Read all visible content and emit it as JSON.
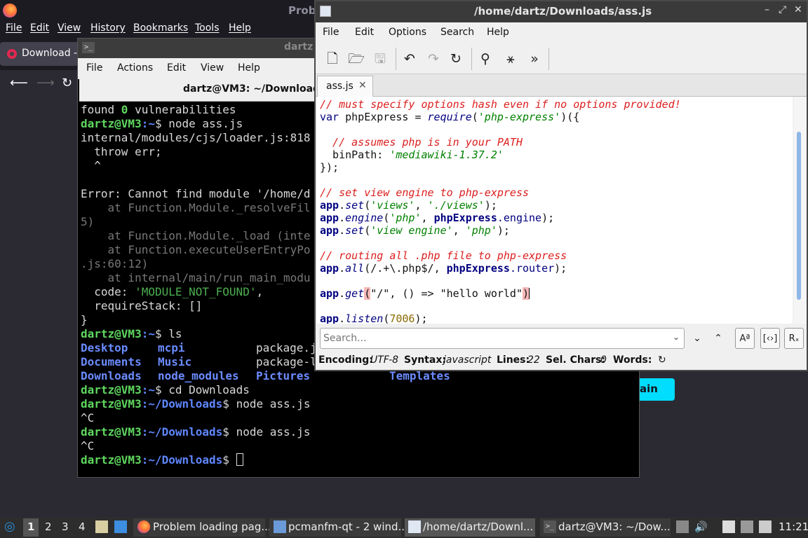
{
  "firefox": {
    "title": "Prob",
    "menu": [
      "File",
      "Edit",
      "View",
      "History",
      "Bookmarks",
      "Tools",
      "Help"
    ],
    "tab_label": "Download -",
    "partial_button": "ain"
  },
  "terminal": {
    "title_partial": "dartz",
    "menu": [
      "File",
      "Actions",
      "Edit",
      "View",
      "Help"
    ],
    "tab_title": "dartz@VM3: ~/Downloads",
    "lines": [
      "found 0 vulnerabilities",
      "dartz@VM3:~$ node ass.js",
      "internal/modules/cjs/loader.js:818",
      "  throw err;",
      "  ^",
      "",
      "Error: Cannot find module '/home/d",
      "    at Function.Module._resolveFil",
      "5)",
      "    at Function.Module._load (inte",
      "    at Function.executeUserEntryPo",
      ".js:60:12)",
      "    at internal/main/run_main_modu",
      "  code: 'MODULE_NOT_FOUND',",
      "  requireStack: []",
      "}",
      "dartz@VM3:~$ ls",
      "Desktop    mcpi           package.j",
      "Documents  Music          package-l",
      "Downloads  node_modules   Pictures         Templates",
      "dartz@VM3:~$ cd Downloads",
      "dartz@VM3:~/Downloads$ node ass.js",
      "^C",
      "dartz@VM3:~/Downloads$ node ass.js",
      "^C",
      "dartz@VM3:~/Downloads$ "
    ],
    "prompt_user": "dartz@VM3",
    "prompt_home": ":~",
    "prompt_dl": ":~/Downloads",
    "found": "found ",
    "zero": "0",
    "vuln": " vulnerabilities",
    "cmd_node": "$ node ass.js",
    "cmd_ls": "$ ls",
    "cmd_cd": "$ cd Downloads",
    "dollar": "$ ",
    "loader": "internal/modules/cjs/loader.js:818",
    "throw": "  throw err;",
    "caret": "  ^",
    "err": "Error: Cannot find module '/home/d",
    "at1": "    at Function.Module._resolveFil",
    "l5": "5)",
    "at2": "    at Function.Module._load (inte",
    "at3": "    at Function.executeUserEntryPo",
    "l60": ".js:60:12)",
    "at4": "    at internal/main/run_main_modu",
    "code_k": "  code: ",
    "code_v": "'MODULE_NOT_FOUND'",
    "code_c": ",",
    "req": "  requireStack: []",
    "brace": "}",
    "ls1a": "Desktop",
    "ls1b": "mcpi",
    "ls1c": "package.j",
    "ls2a": "Documents",
    "ls2b": "Music",
    "ls2c": "package-l",
    "ls3a": "Downloads",
    "ls3b": "node_modules",
    "ls3c": "Pictures",
    "ls3d": "Templates",
    "ctrlc": "^C"
  },
  "editor": {
    "title": "/home/dartz/Downloads/ass.js",
    "menu": [
      "File",
      "Edit",
      "Options",
      "Search",
      "Help"
    ],
    "tab": "ass.js",
    "search_placeholder": "Search...",
    "status": {
      "enc_k": "Encoding:",
      "enc_v": "UTF-8",
      "syn_k": "Syntax:",
      "syn_v": "javascript",
      "lines_k": "Lines:",
      "lines_v": "22",
      "sel_k": "Sel. Chars:",
      "sel_v": "0",
      "words_k": "Words:"
    },
    "code": {
      "c1": "// must specify options hash even if no options provided!",
      "var": "var",
      "phpExpress_decl": " phpExpress = ",
      "require": "require",
      "req_arg": "'php-express'",
      "req_close": ")({",
      "c2": "  // assumes php is in your PATH",
      "binPath": "  binPath: ",
      "binPath_v": "'mediawiki-1.37.2'",
      "close": "});",
      "c3": "// set view engine to php-express",
      "app": "app",
      "set": "set",
      "engine": "engine",
      "all": "all",
      "get": "get",
      "listen": "listen",
      "views_k": "'views'",
      "views_v": "'./views'",
      "php": "'php'",
      "phpExpress": "phpExpress",
      "engine_prop": ".engine",
      "ve_k": "'view engine'",
      "c4": "// routing all .php file to php-express",
      "regex": "/.+\\.php$/",
      "router_prop": ".router",
      "slash": "\"/\"",
      "arrow": ", () => ",
      "hello": "\"hello world\"",
      "port": "7006"
    }
  },
  "taskbar": {
    "desktops": [
      "1",
      "2",
      "3",
      "4"
    ],
    "tasks": [
      "Problem loading pag...",
      "pcmanfm-qt - 2 wind...",
      "/home/dartz/Downl...",
      "dartz@VM3: ~/Dow..."
    ],
    "clock": "11:21"
  }
}
